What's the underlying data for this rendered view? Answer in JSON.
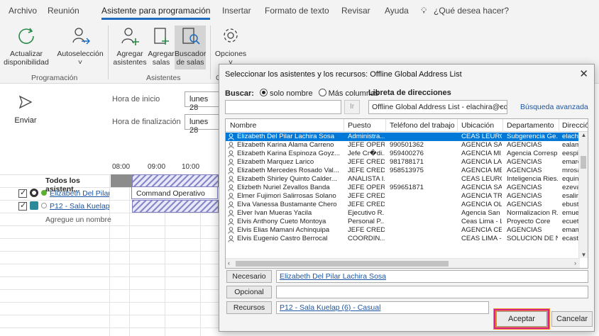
{
  "menu": [
    "Archivo",
    "Reunión",
    "Asistente para programación",
    "Insertar",
    "Formato de texto",
    "Revisar",
    "Ayuda",
    "¿Qué desea hacer?"
  ],
  "ribbon": {
    "refresh_l1": "Actualizar",
    "refresh_l2": "disponibilidad",
    "autoselect_l1": "Autoselección",
    "autoselect_l2": "˅",
    "add_att_l1": "Agregar",
    "add_att_l2": "asistentes",
    "add_rooms_l1": "Agregar",
    "add_rooms_l2": "salas",
    "room_finder_l1": "Buscador",
    "room_finder_l2": "de salas",
    "options_l1": "Opciones",
    "options_l2": "˅",
    "group_programacion": "Programación",
    "group_asistentes": "Asistentes",
    "group_opciones_cut": "O"
  },
  "schedule": {
    "send": "Enviar",
    "start_label": "Hora de inicio",
    "end_label": "Hora de finalización",
    "start_value": "lunes 28",
    "end_value": "lunes 28",
    "hours": [
      "08:00",
      "09:00",
      "10:00"
    ],
    "all_attendees": "Todos los asistent...",
    "attendee1": "Elizabeth Del Pilar",
    "attendee2": "P12 - Sala Kuelap",
    "add_name": "Agregue un nombre",
    "meeting_block": "Command Operativo"
  },
  "dialog": {
    "title": "Seleccionar los asistentes y los recursos: Offline Global Address List",
    "search_label": "Buscar:",
    "radio_name": "solo nombre",
    "radio_more": "Más columnas",
    "address_book_label": "Libreta de direcciones",
    "address_book_value": "Offline Global Address List - elachira@com",
    "go": "Ir",
    "advanced": "Búsqueda avanzada",
    "columns": [
      "Nombre",
      "Puesto",
      "Teléfono del trabajo",
      "Ubicación",
      "Departamento",
      "Dirección"
    ],
    "rows": [
      [
        "Elizabeth Del Pilar Lachira Sosa",
        "Administra...",
        "",
        "CEAS LEURO",
        "Subgerencia Ge...",
        "elachira"
      ],
      [
        "Elizabeth Karina Alama Carreno",
        "JEFE OPER...",
        "990501362",
        "AGENCIA SA...",
        "AGENCIAS",
        "ealama"
      ],
      [
        "Elizabeth Karina Espinoza Goyz...",
        "Jefe Cr�di...",
        "959400276",
        "AGENCIA MI...",
        "Agencia Corresp...",
        "eespin"
      ],
      [
        "Elizabeth Marquez Larico",
        "JEFE CREDI...",
        "981788171",
        "AGENCIA LA ...",
        "AGENCIAS",
        "emarqu"
      ],
      [
        "Elizabeth Mercedes Rosado Val...",
        "JEFE CREDI...",
        "958513975",
        "AGENCIA ME...",
        "AGENCIAS",
        "mrosac"
      ],
      [
        "Elizabeth Shirley Quinto Calder...",
        "ANALISTA I...",
        "",
        "CEAS LEURO",
        "Inteligencia Ries...",
        "equint"
      ],
      [
        "Elizbeth Nuriel Zevallos Banda",
        "JEFE OPER...",
        "959651871",
        "AGENCIA SA...",
        "AGENCIAS",
        "ezevall"
      ],
      [
        "Elmer Fujimori Salirrosas Solano",
        "JEFE CREDI...",
        "",
        "AGENCIA TR...",
        "AGENCIAS",
        "esalirrc"
      ],
      [
        "Elva Vanessa Bustamante Chero",
        "JEFE CREDI...",
        "",
        "AGENCIA OL...",
        "AGENCIAS",
        "ebusta"
      ],
      [
        "Elver Ivan Mueras Yacila",
        "Ejecutivo R...",
        "",
        "Agencia San ...",
        "Normalizacion R...",
        "emuera"
      ],
      [
        "Elvis Anthony Cueto Montoya",
        "Personal P...",
        "",
        "Ceas Lima - L...",
        "Proyecto Core",
        "ecueto"
      ],
      [
        "Elvis Elias Mamani Achinquipa",
        "JEFE CREDI...",
        "",
        "AGENCIA CE...",
        "AGENCIAS",
        "emama"
      ],
      [
        "Elvis Eugenio Castro Berrocal",
        "COORDIN...",
        "",
        "CEAS LIMA - ...",
        "SOLUCION DE N...",
        "ecastro"
      ]
    ],
    "required_btn": "Necesario",
    "required_value": "Elizabeth Del Pilar Lachira Sosa",
    "optional_btn": "Opcional",
    "optional_value": "",
    "resources_btn": "Recursos",
    "resources_value": "P12 - Sala Kuelap (6) - Casual",
    "ok": "Aceptar",
    "cancel": "Cancelar"
  },
  "colors": {
    "accent": "#1e6cc0",
    "selection": "#0078d7",
    "highlight_inner": "#d6208c",
    "highlight_outer": "#f08a2a"
  }
}
